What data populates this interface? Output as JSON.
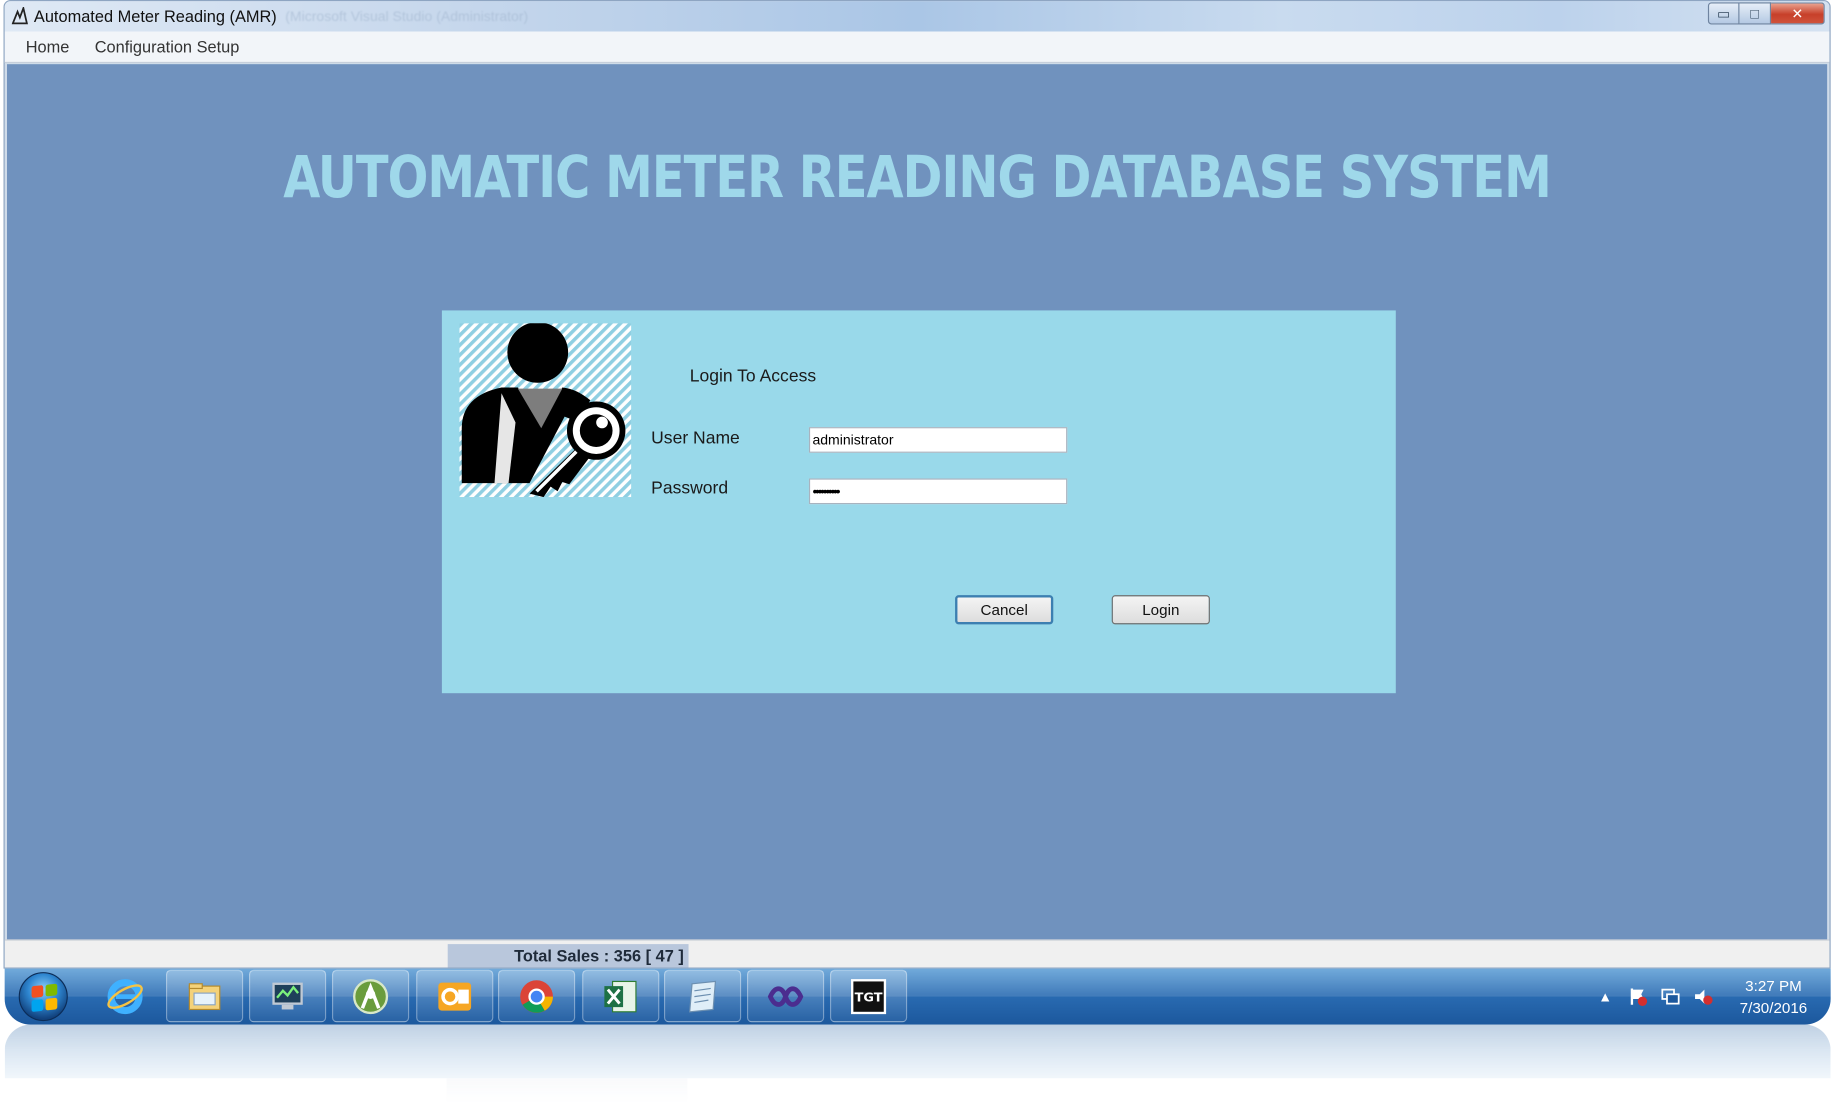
{
  "window": {
    "title": "Automated Meter Reading (AMR)",
    "background_title": "(Microsoft Visual Studio (Administrator)",
    "controls": {
      "minimize": "▭",
      "maximize": "□",
      "close": "✕"
    }
  },
  "menu": {
    "items": [
      "Home",
      "Configuration Setup"
    ]
  },
  "main": {
    "headline": "AUTOMATIC METER READING DATABASE SYSTEM"
  },
  "login": {
    "title": "Login To Access",
    "username_label": "User Name",
    "username_value": "administrator",
    "password_label": "Password",
    "password_value": "••••••••••",
    "cancel_label": "Cancel",
    "login_label": "Login"
  },
  "status": {
    "text": "Total Sales : 356 [ 47 ]"
  },
  "taskbar": {
    "apps": [
      "internet-explorer-icon",
      "file-explorer-icon",
      "remote-desktop-icon",
      "android-studio-icon",
      "outlook-icon",
      "chrome-icon",
      "excel-icon",
      "notepad-icon",
      "visual-studio-icon",
      "tgt-app-icon"
    ],
    "clock_time": "3:27 PM",
    "clock_date": "7/30/2016"
  },
  "colors": {
    "client_background": "#7092be",
    "headline": "#9fd8ea",
    "login_panel": "#99d9ea",
    "taskbar": "#2a6cb3"
  }
}
